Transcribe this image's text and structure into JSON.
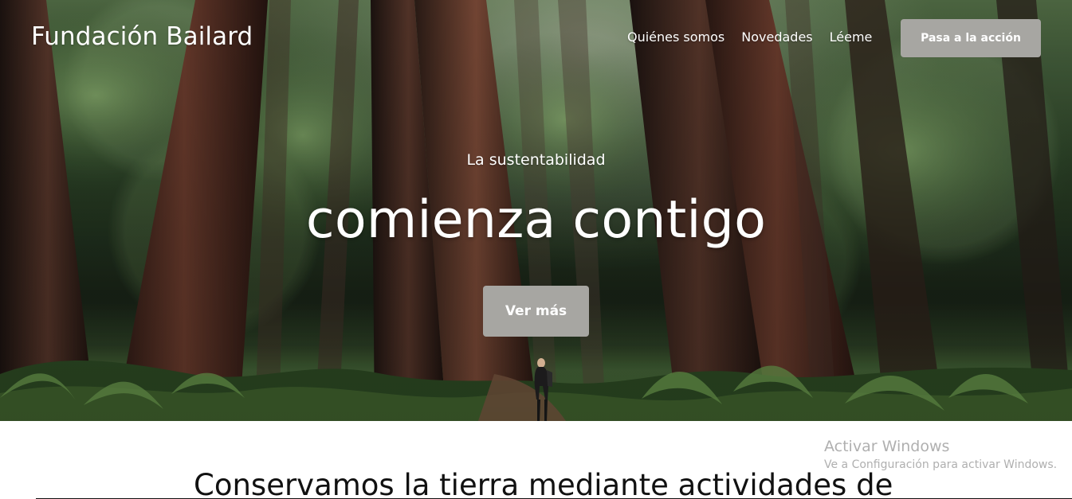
{
  "header": {
    "brand": "Fundación Bailard",
    "nav_items": [
      {
        "label": "Quiénes somos"
      },
      {
        "label": "Novedades"
      },
      {
        "label": "Léeme"
      }
    ],
    "cta_label": "Pasa a la acción"
  },
  "hero": {
    "kicker": "La sustentabilidad",
    "title": "comienza contigo",
    "button_label": "Ver más"
  },
  "content": {
    "heading_partial": "Conservamos la tierra mediante actividades de"
  },
  "watermark": {
    "title": "Activar Windows",
    "subtitle": "Ve a Configuración para activar Windows."
  },
  "colors": {
    "button": "#a7a6a2",
    "text_light": "#ffffff",
    "text_dark": "#111111"
  },
  "icons": {
    "person": "hiker-silhouette-icon"
  }
}
